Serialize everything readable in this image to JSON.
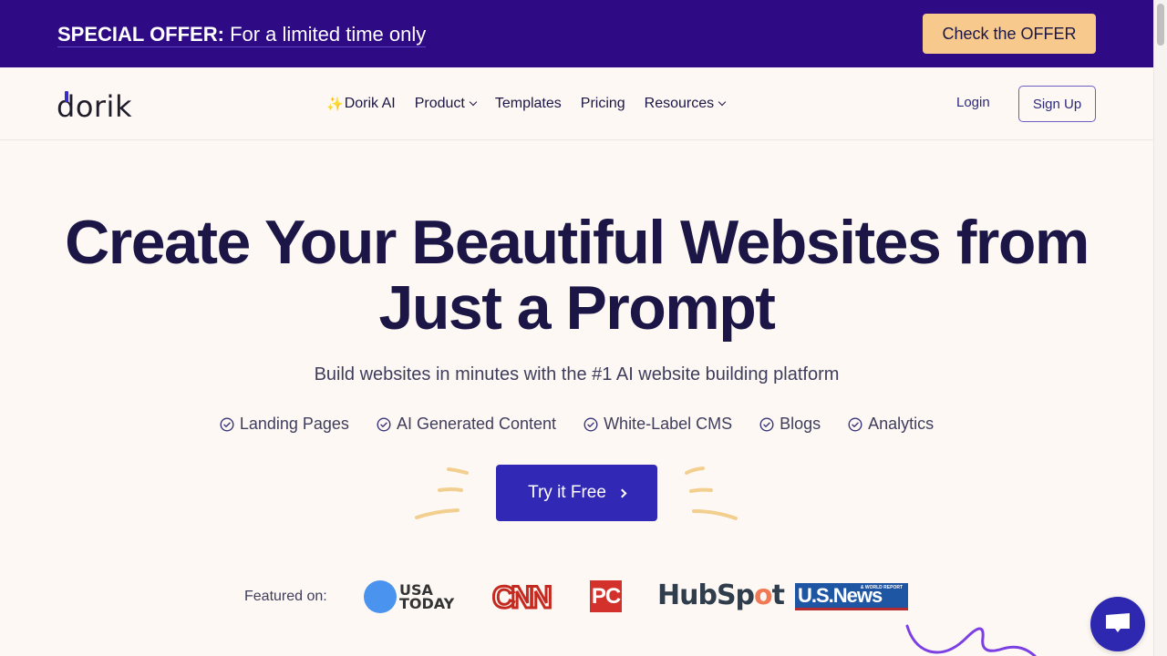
{
  "promo": {
    "label_bold": "SPECIAL OFFER:",
    "label_rest": " For a limited time only",
    "button": "Check the OFFER"
  },
  "nav": {
    "logo": "dorik",
    "links": [
      {
        "label": "Dorik AI",
        "icon": "sparkles-icon",
        "dropdown": false
      },
      {
        "label": "Product",
        "dropdown": true
      },
      {
        "label": "Templates",
        "dropdown": false
      },
      {
        "label": "Pricing",
        "dropdown": false
      },
      {
        "label": "Resources",
        "dropdown": true
      }
    ],
    "sparkle_glyph": "✨",
    "login": "Login",
    "signup": "Sign Up"
  },
  "hero": {
    "title_line1": "Create Your Beautiful Websites from",
    "title_line2": "Just a Prompt",
    "subtitle": "Build websites in minutes with the #1 AI website building platform",
    "features": [
      "Landing Pages",
      "AI Generated Content",
      "White-Label CMS",
      "Blogs",
      "Analytics"
    ],
    "cta": "Try it Free"
  },
  "featured": {
    "label": "Featured on:",
    "logos": {
      "usa_today_line1": "USA",
      "usa_today_line2": "TODAY",
      "cnn": "CNN",
      "pc": "PC",
      "hubspot_a": "HubSp",
      "hubspot_o": "o",
      "hubspot_b": "t",
      "usnews": "U.S.News",
      "usnews_small": "& WORLD REPORT"
    }
  },
  "colors": {
    "promo_bg": "#2e0a85",
    "offer_btn": "#f7c98c",
    "primary": "#3129b5",
    "heading": "#1b1646",
    "page_bg": "#fdf8f3"
  }
}
